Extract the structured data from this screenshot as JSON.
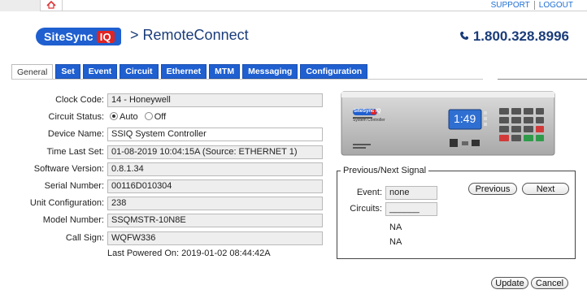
{
  "topbar": {
    "home_icon": "home-icon",
    "support_label": "SUPPORT",
    "logout_label": "LOGOUT"
  },
  "header": {
    "brand": "SiteSync",
    "brand_iq": "IQ",
    "separator": ">",
    "app_title": "RemoteConnect",
    "phone_icon": "phone-icon",
    "phone": "1.800.328.8996"
  },
  "tabs": [
    {
      "label": "General",
      "active": true
    },
    {
      "label": "Set"
    },
    {
      "label": "Event"
    },
    {
      "label": "Circuit"
    },
    {
      "label": "Ethernet"
    },
    {
      "label": "MTM"
    },
    {
      "label": "Messaging"
    },
    {
      "label": "Configuration"
    }
  ],
  "form": {
    "clock_code": {
      "label": "Clock Code:",
      "value": "14 - Honeywell"
    },
    "circuit_status": {
      "label": "Circuit Status:",
      "options": [
        "Auto",
        "Off"
      ],
      "selected": "Auto"
    },
    "device_name": {
      "label": "Device Name:",
      "value": "SSIQ System Controller"
    },
    "time_last_set": {
      "label": "Time Last Set:",
      "value": "01-08-2019 10:04:15A (Source: ETHERNET 1)"
    },
    "software_version": {
      "label": "Software Version:",
      "value": "0.8.1.34"
    },
    "serial_number": {
      "label": "Serial Number:",
      "value": "00116D010304"
    },
    "unit_configuration": {
      "label": "Unit Configuration:",
      "value": "238"
    },
    "model_number": {
      "label": "Model Number:",
      "value": "SSQMSTR-10N8E"
    },
    "call_sign": {
      "label": "Call Sign:",
      "value": "WQFW336"
    },
    "last_powered": "Last Powered On: 2019-01-02 08:44:42A"
  },
  "device": {
    "brand": "SiteSync",
    "brand_iq": "IQ",
    "model": "System Controller",
    "display_time": "1:49",
    "colors": {
      "body": "#c9c9c9",
      "screen": "#2f6fd1",
      "red_key": "#d23a3a",
      "green_key": "#2f9b4a"
    }
  },
  "signal": {
    "legend": "Previous/Next Signal",
    "event_label": "Event:",
    "event_value": "none",
    "circuits_label": "Circuits:",
    "circuits_value": "______",
    "na_1": "NA",
    "na_2": "NA",
    "previous_label": "Previous",
    "next_label": "Next"
  },
  "actions": {
    "update_label": "Update",
    "cancel_label": "Cancel"
  },
  "colors": {
    "accent": "#1f5fd0",
    "link": "#1f6fd6",
    "title": "#1a3c7a",
    "brand_red": "#e02424"
  }
}
